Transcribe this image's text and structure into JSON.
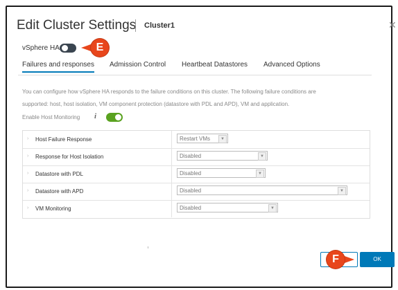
{
  "dialog": {
    "title": "Edit Cluster Settings",
    "cluster_name": "Cluster1",
    "close_icon": "close-icon"
  },
  "vsphere_ha": {
    "label": "vSphere HA",
    "enabled": false
  },
  "annotations": {
    "e": "E",
    "f": "F",
    "color": "#e8461c"
  },
  "tabs": [
    {
      "label": "Failures and responses",
      "active": true
    },
    {
      "label": "Admission Control",
      "active": false
    },
    {
      "label": "Heartbeat Datastores",
      "active": false
    },
    {
      "label": "Advanced Options",
      "active": false
    }
  ],
  "description": {
    "line1": "You can configure how vSphere HA responds to the failure conditions on this cluster. The following failure conditions are",
    "line2": "supported: host, host isolation, VM component protection (datastore with PDL and APD), VM and application."
  },
  "host_monitoring": {
    "label": "Enable Host Monitoring",
    "enabled": true
  },
  "settings": [
    {
      "label": "Host Failure Response",
      "value": "Restart VMs"
    },
    {
      "label": "Response for Host Isolation",
      "value": "Disabled"
    },
    {
      "label": "Datastore with PDL",
      "value": "Disabled"
    },
    {
      "label": "Datastore with APD",
      "value": "Disabled"
    },
    {
      "label": "VM Monitoring",
      "value": "Disabled"
    }
  ],
  "footer": {
    "cancel_label": "",
    "ok_label": "OK"
  },
  "colors": {
    "accent": "#0079b8",
    "toggle_on": "#5aa220",
    "toggle_off": "#3a4550"
  }
}
